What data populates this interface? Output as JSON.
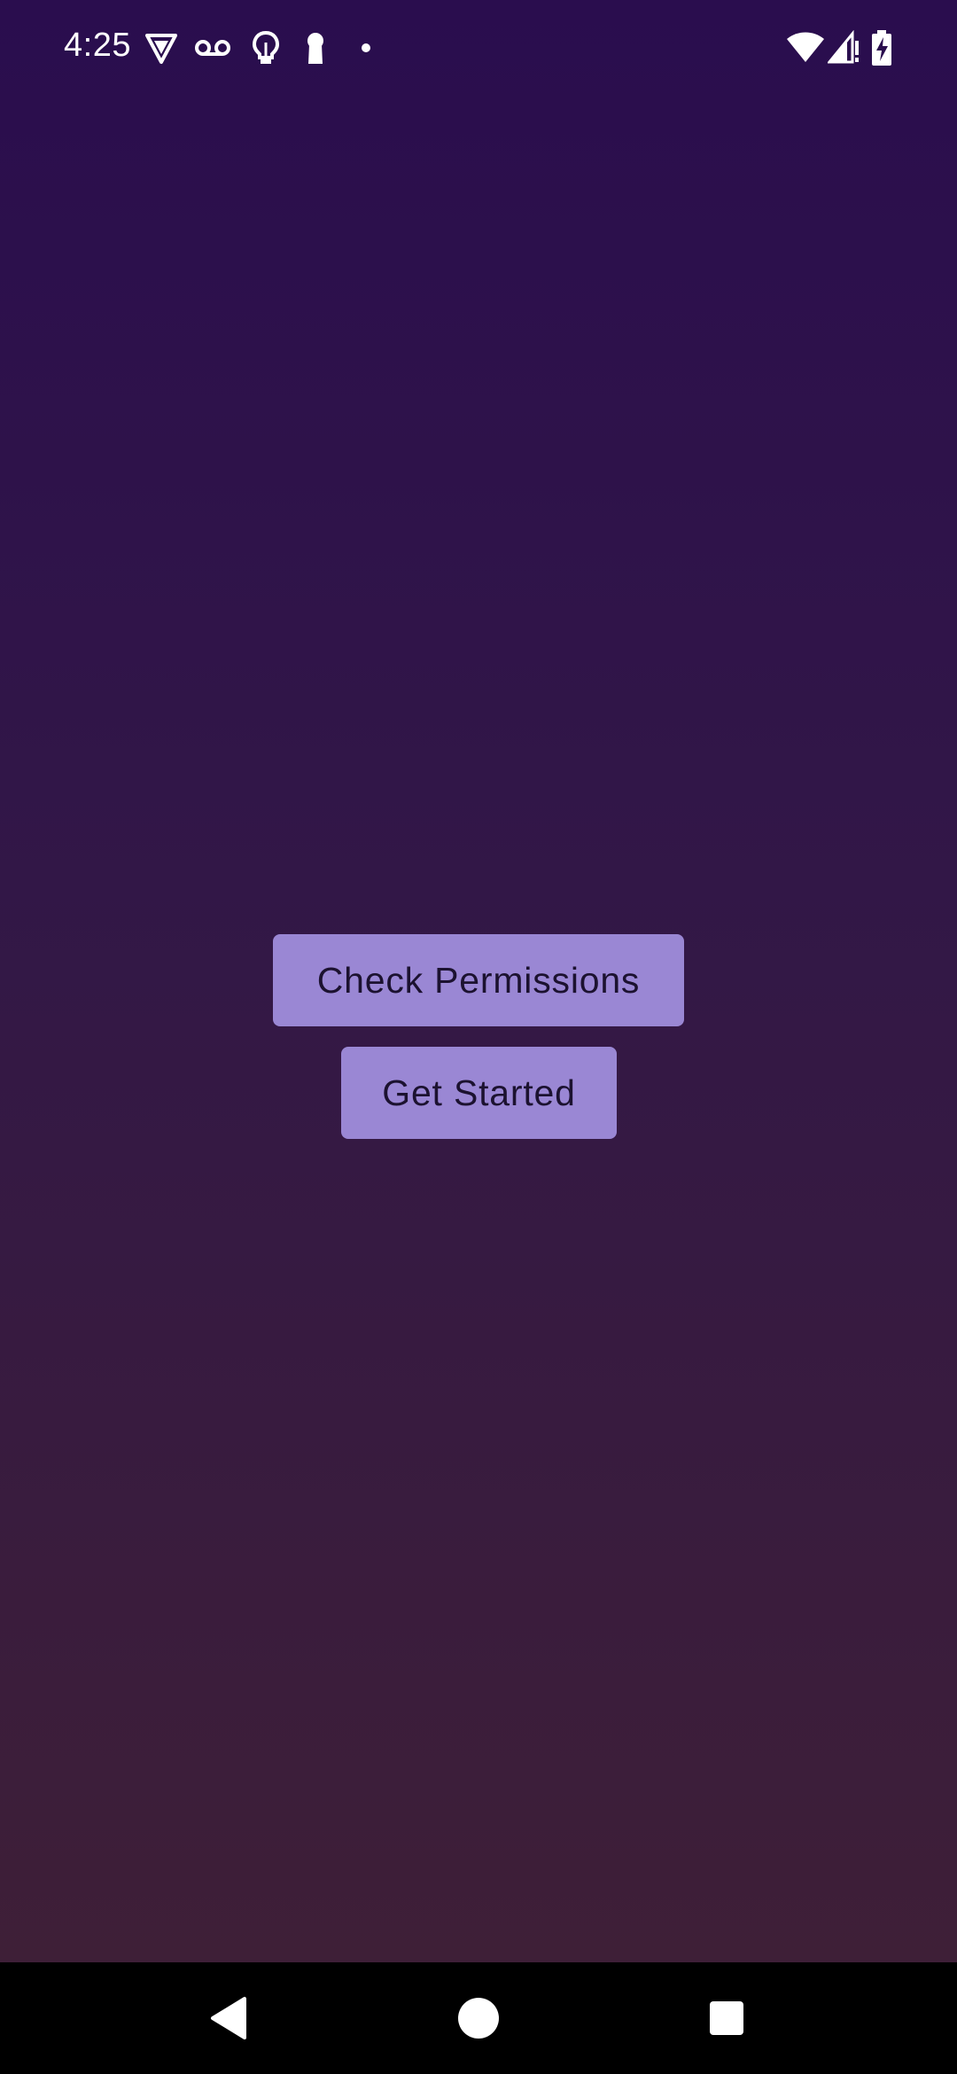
{
  "status_bar": {
    "time": "4:25",
    "left_icons": [
      "vpn-shield-icon",
      "voicemail-icon",
      "lightbulb-icon",
      "keyhole-icon",
      "notification-dot-icon"
    ],
    "right_icons": [
      "wifi-icon",
      "cell-signal-icon",
      "battery-charging-icon"
    ]
  },
  "main": {
    "check_permissions_label": "Check Permissions",
    "get_started_label": "Get Started"
  },
  "nav_bar": {
    "buttons": [
      "back-icon",
      "home-icon",
      "recents-icon"
    ]
  },
  "colors": {
    "background_top": "#2a0d4e",
    "background_bottom": "#3e1f37",
    "button_fill": "#9a87d4",
    "button_text": "#1c1230",
    "nav_bar": "#000000"
  }
}
